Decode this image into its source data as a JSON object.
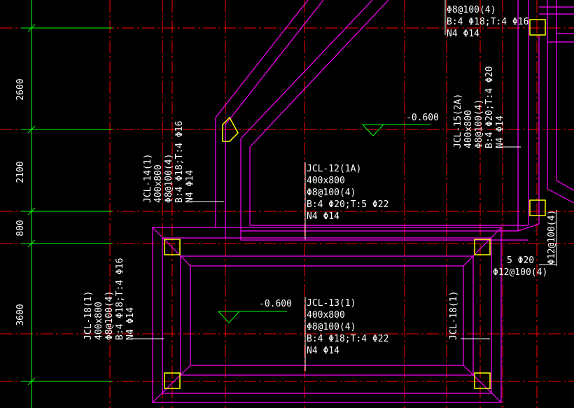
{
  "colors": {
    "background": "#000000",
    "grid": "#ff0000",
    "beam": "#ff00ff",
    "column": "#ffff00",
    "dimension": "#00ff00",
    "text": "#ffffff",
    "level_marker": "#00ff00"
  },
  "dimensions": {
    "d1": "2600",
    "d2": "2100",
    "d3": "800",
    "d4": "3600"
  },
  "levels": {
    "upper": "-0.600",
    "lower": "-0.600"
  },
  "labels": {
    "top_right": {
      "l1": "Φ8@100(4)",
      "l2": "B:4 Φ18;T:4 Φ16",
      "l3": "N4 Φ14"
    },
    "jcl12": {
      "l1": "JCL-12(1A)",
      "l2": "400x800",
      "l3": "Φ8@100(4)",
      "l4": "B:4 Φ20;T:5 Φ22",
      "l5": "N4 Φ14"
    },
    "jcl13": {
      "l1": "JCL-13(1)",
      "l2": "400x800",
      "l3": "Φ8@100(4)",
      "l4": "B:4 Φ18;T:4 Φ22",
      "l5": "N4 Φ14"
    },
    "jcl14": {
      "l1": "JCL-14(1)",
      "l2": "400x800",
      "l3": "Φ8@100(4)",
      "l4": "B:4 Φ18;T:4 Φ16",
      "l5": "N4 Φ14"
    },
    "jcl15": {
      "l1": "JCL-15(2A)",
      "l2": "400x800",
      "l3": "Φ8@100(4)",
      "l4": "B:4 Φ20;T:4 Φ20",
      "l5": "N4 Φ14"
    },
    "jcl18_left": {
      "l1": "JCL-18(1)",
      "l2": "400x800",
      "l3": "Φ8@100(4)",
      "l4": "B:4 Φ18;T:4 Φ16",
      "l5": "N4 Φ14"
    },
    "jcl18_right": {
      "l1": "JCL-18(1)"
    },
    "right_edge": {
      "vertical": "Φ12@100(4)",
      "top": "5 Φ20",
      "bottom": "Φ12@100(4)"
    }
  }
}
